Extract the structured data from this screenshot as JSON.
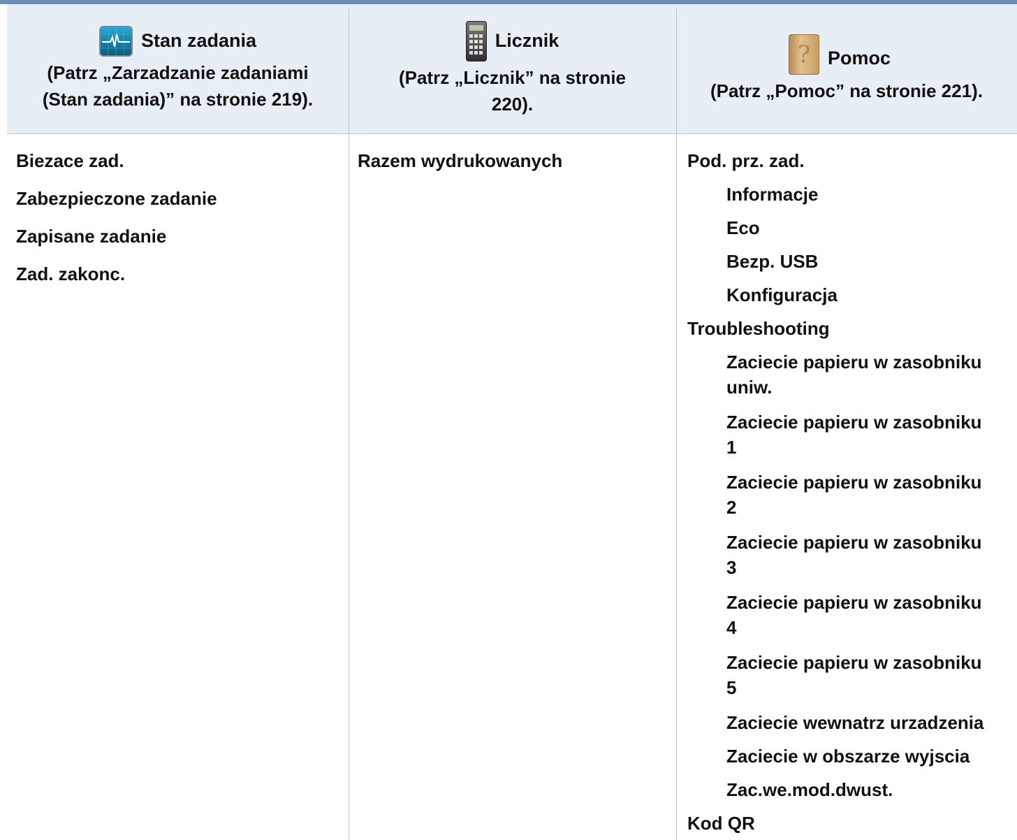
{
  "columns": [
    {
      "title": "Stan zadania",
      "icon": "job-status-icon",
      "ref_line1": "(Patrz „Zarzadzanie zadaniami",
      "ref_line2": "(Stan zadania)” na stronie 219).",
      "items": [
        "Biezace zad.",
        "Zabezpieczone zadanie",
        "Zapisane zadanie",
        "Zad. zakonc."
      ]
    },
    {
      "title": "Licznik",
      "icon": "calculator-icon",
      "ref_line1": "(Patrz „Licznik” na stronie",
      "ref_line2": "220).",
      "items": [
        "Razem wydrukowanych"
      ]
    },
    {
      "title": "Pomoc",
      "icon": "help-book-icon",
      "ref_line1": "(Patrz „Pomoc” na stronie 221).",
      "items": [
        {
          "label": "Pod. prz. zad.",
          "level": 0
        },
        {
          "label": "Informacje",
          "level": 1
        },
        {
          "label": "Eco",
          "level": 1
        },
        {
          "label": "Bezp. USB",
          "level": 1
        },
        {
          "label": "Konfiguracja",
          "level": 1
        },
        {
          "label": "Troubleshooting",
          "level": 0
        },
        {
          "label": "Zaciecie papieru w zasobniku",
          "label2": "uniw.",
          "level": 1
        },
        {
          "label": "Zaciecie papieru w zasobniku",
          "label2": "1",
          "level": 1
        },
        {
          "label": "Zaciecie papieru w zasobniku",
          "label2": "2",
          "level": 1
        },
        {
          "label": "Zaciecie papieru w zasobniku",
          "label2": "3",
          "level": 1
        },
        {
          "label": "Zaciecie papieru w zasobniku",
          "label2": "4",
          "level": 1
        },
        {
          "label": "Zaciecie papieru w zasobniku",
          "label2": "5",
          "level": 1
        },
        {
          "label": "Zaciecie wewnatrz urzadzenia",
          "level": 1
        },
        {
          "label": "Zaciecie w obszarze wyjscia",
          "level": 1
        },
        {
          "label": "Zac.we.mod.dwust.",
          "level": 1
        },
        {
          "label": "Kod QR",
          "level": 0
        }
      ]
    }
  ]
}
